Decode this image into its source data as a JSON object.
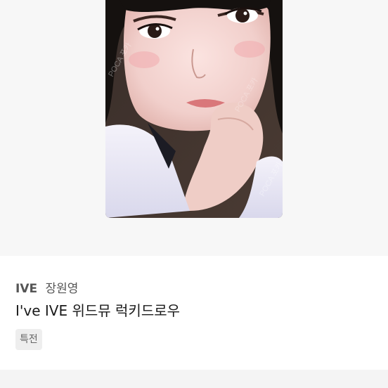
{
  "product": {
    "group": "IVE",
    "member": "장원영",
    "title": "I've IVE 위드뮤 럭키드로우",
    "tag": "특전"
  },
  "image": {
    "icon": "photocard-image",
    "watermark": "POCA 포카"
  },
  "colors": {
    "page_bg": "#ffffff",
    "image_bg": "#f7f7f7",
    "tag_bg": "#eeeeee",
    "title_text": "#1a1a1a",
    "meta_text": "#555555"
  }
}
